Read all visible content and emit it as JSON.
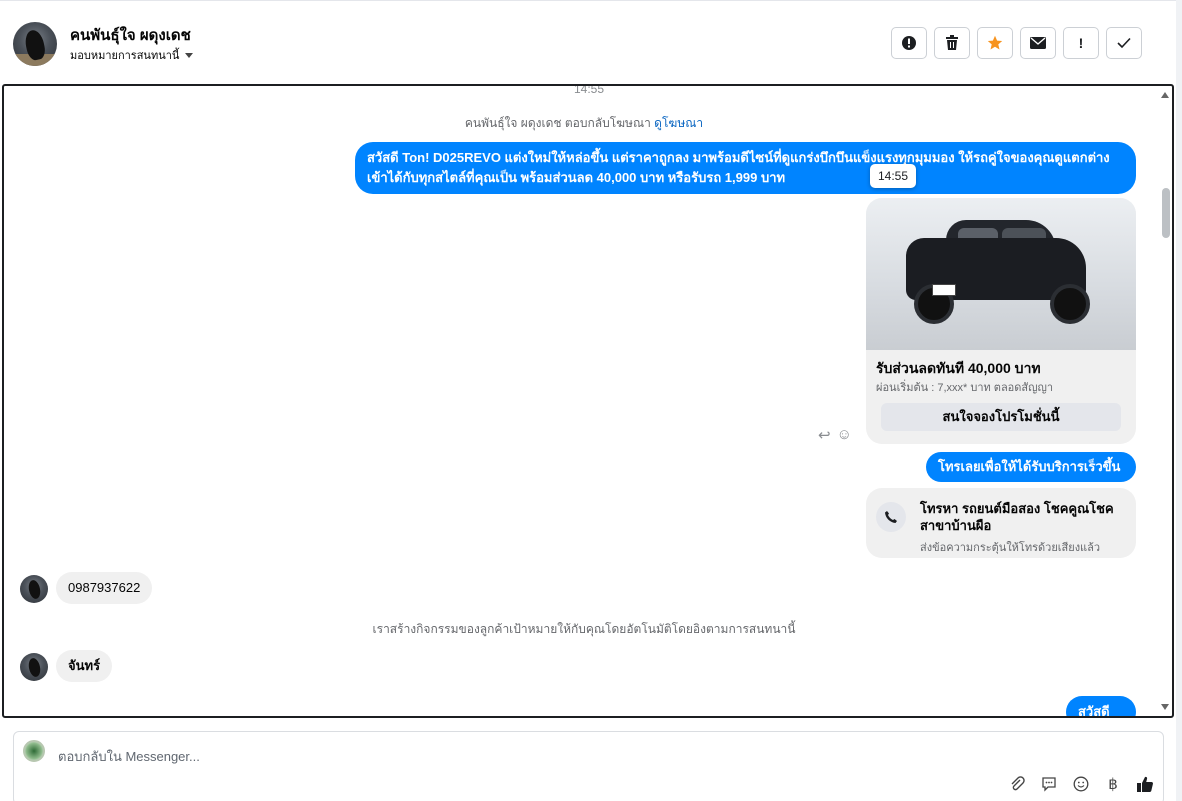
{
  "header": {
    "contact_name": "คนพันธุ์ใจ ผดุงเดช",
    "assign_label": "มอบหมายการสนทนานี้",
    "toolbar": [
      {
        "name": "spam-button",
        "glyph": "⏺"
      },
      {
        "name": "delete-button",
        "glyph": "🗑"
      },
      {
        "name": "star-button",
        "glyph": "★"
      },
      {
        "name": "mark-unread-button",
        "glyph": "✉"
      },
      {
        "name": "follow-up-button",
        "glyph": "!"
      },
      {
        "name": "done-button",
        "glyph": "✓"
      }
    ]
  },
  "chat": {
    "time_top": "14:55",
    "ad_reply_text": "คนพันธุ์ใจ ผดุงเดช ตอบกลับโฆษณา",
    "ad_reply_link": "ดูโฆษณา",
    "msg1": "สวัสดี Ton! D025REVO แต่งใหม่ให้หล่อขึ้น แต่ราคาถูกลง มาพร้อมดีไซน์ที่ดูแกร่งบึกบึนแข็งแรงทุกมุมมอง ให้รถคู่ใจของคุณดูแตกต่าง เข้าได้กับทุกสไตล์ที่คุณเป็น พร้อมส่วนลด 40,000 บาท หรือรับรถ 1,999 บาท",
    "tooltip_time": "14:55",
    "card": {
      "title": "รับส่วนลดทันที  40,000 บาท",
      "subtitle": "ผ่อนเริ่มต้น : 7,xxx* บาท ตลอดสัญญา",
      "button": "สนใจจองโปรโมชั่นนี้"
    },
    "msg2": "โทรเลยเพื่อให้ได้รับบริการเร็วขึ้น",
    "call": {
      "title": "โทรหา รถยนต์มือสอง โชคคูณโชค สาขาบ้านผือ",
      "subtitle": "ส่งข้อความกระตุ้นให้โทรด้วยเสียงแล้ว"
    },
    "incoming1": "0987937622",
    "system_note": "เราสร้างกิจกรรมของลูกค้าเป้าหมายให้กับคุณโดยอัตโนมัติโดยอิงตามการสนทนานี้",
    "incoming2": "จันทร์",
    "msg3": "สวัสดีค่ะ"
  },
  "composer": {
    "placeholder": "ตอบกลับใน Messenger..."
  },
  "colors": {
    "accent": "#0084ff",
    "star": "#f7931e",
    "bubble_in": "#f0f0f0"
  }
}
